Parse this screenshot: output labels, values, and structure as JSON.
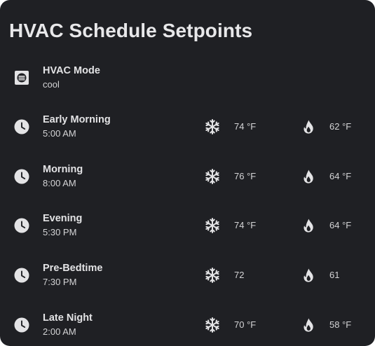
{
  "card": {
    "title": "HVAC Schedule Setpoints"
  },
  "colors": {
    "background": "#1f2024",
    "text": "#e3e3e5",
    "icon": "#e3e3e5"
  },
  "mode_row": {
    "icon": "thermostat-mode-icon",
    "name": "HVAC Mode",
    "value": "cool"
  },
  "schedule": [
    {
      "name": "Early Morning",
      "time": "5:00 AM",
      "cool": "74 °F",
      "heat": "62 °F"
    },
    {
      "name": "Morning",
      "time": "8:00 AM",
      "cool": "76 °F",
      "heat": "64 °F"
    },
    {
      "name": "Evening",
      "time": "5:30 PM",
      "cool": "74 °F",
      "heat": "64 °F"
    },
    {
      "name": "Pre-Bedtime",
      "time": "7:30 PM",
      "cool": "72",
      "heat": "61"
    },
    {
      "name": "Late Night",
      "time": "2:00 AM",
      "cool": "70 °F",
      "heat": "58 °F"
    }
  ],
  "icons": {
    "row": "clock-icon",
    "cool": "snowflake-icon",
    "heat": "fire-icon"
  }
}
